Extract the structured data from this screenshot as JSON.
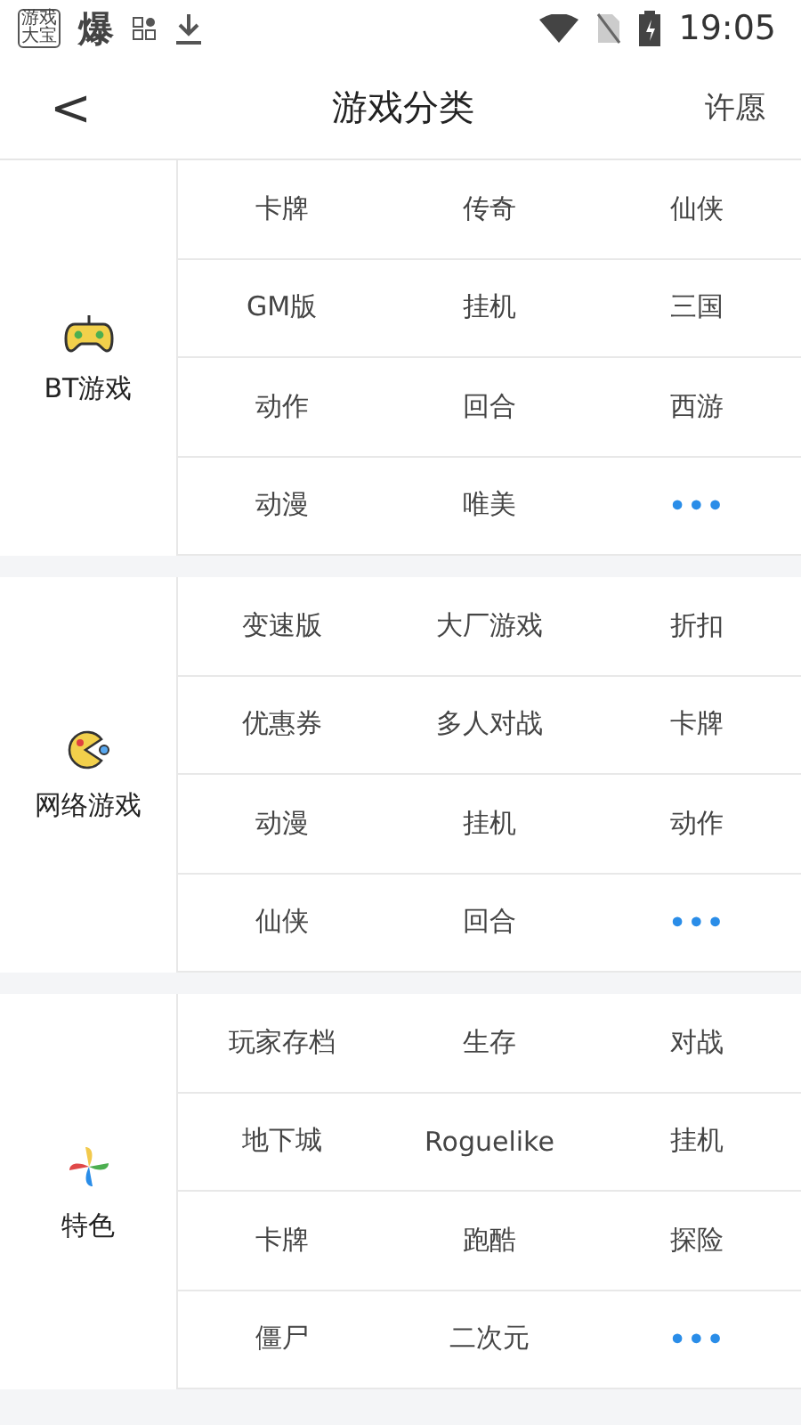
{
  "status_bar": {
    "app_badge": [
      "游戏",
      "大宝"
    ],
    "notice": "爆",
    "time": "19:05"
  },
  "header": {
    "back": "<",
    "title": "游戏分类",
    "action": "许愿"
  },
  "sections": [
    {
      "name": "BT游戏",
      "items": [
        {
          "kind": "tag",
          "label": "卡牌"
        },
        {
          "kind": "tag",
          "label": "传奇"
        },
        {
          "kind": "tag",
          "label": "仙侠"
        },
        {
          "kind": "tag",
          "label": "GM版"
        },
        {
          "kind": "tag",
          "label": "挂机"
        },
        {
          "kind": "tag",
          "label": "三国"
        },
        {
          "kind": "tag",
          "label": "动作"
        },
        {
          "kind": "tag",
          "label": "回合"
        },
        {
          "kind": "tag",
          "label": "西游"
        },
        {
          "kind": "tag",
          "label": "动漫"
        },
        {
          "kind": "tag",
          "label": "唯美"
        },
        {
          "kind": "more",
          "label": "•••"
        }
      ]
    },
    {
      "name": "网络游戏",
      "items": [
        {
          "kind": "tag",
          "label": "变速版"
        },
        {
          "kind": "tag",
          "label": "大厂游戏"
        },
        {
          "kind": "tag",
          "label": "折扣"
        },
        {
          "kind": "tag",
          "label": "优惠券"
        },
        {
          "kind": "tag",
          "label": "多人对战"
        },
        {
          "kind": "tag",
          "label": "卡牌"
        },
        {
          "kind": "tag",
          "label": "动漫"
        },
        {
          "kind": "tag",
          "label": "挂机"
        },
        {
          "kind": "tag",
          "label": "动作"
        },
        {
          "kind": "tag",
          "label": "仙侠"
        },
        {
          "kind": "tag",
          "label": "回合"
        },
        {
          "kind": "more",
          "label": "•••"
        }
      ]
    },
    {
      "name": "特色",
      "items": [
        {
          "kind": "tag",
          "label": "玩家存档"
        },
        {
          "kind": "tag",
          "label": "生存"
        },
        {
          "kind": "tag",
          "label": "对战"
        },
        {
          "kind": "tag",
          "label": "地下城"
        },
        {
          "kind": "tag",
          "label": "Roguelike"
        },
        {
          "kind": "tag",
          "label": "挂机"
        },
        {
          "kind": "tag",
          "label": "卡牌"
        },
        {
          "kind": "tag",
          "label": "跑酷"
        },
        {
          "kind": "tag",
          "label": "探险"
        },
        {
          "kind": "tag",
          "label": "僵尸"
        },
        {
          "kind": "tag",
          "label": "二次元"
        },
        {
          "kind": "more",
          "label": "•••"
        }
      ]
    }
  ]
}
